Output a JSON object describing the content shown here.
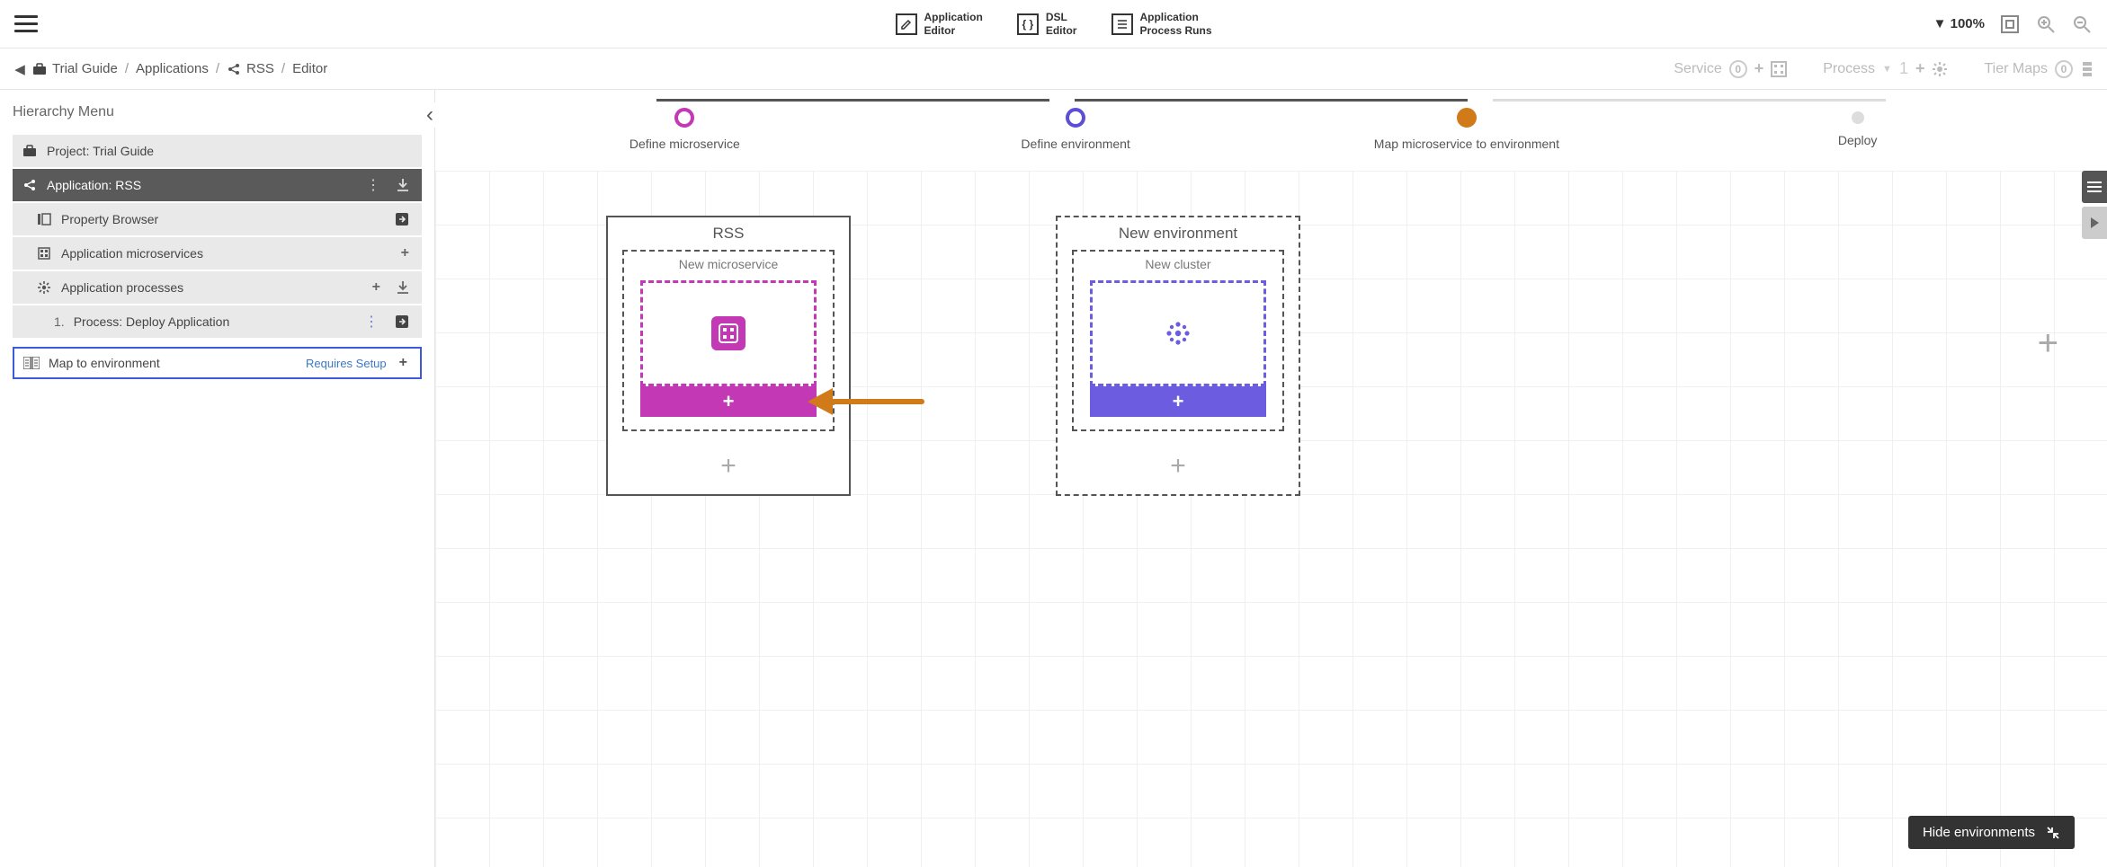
{
  "topbar": {
    "tabs": [
      {
        "line1": "Application",
        "line2": "Editor"
      },
      {
        "line1": "DSL",
        "line2": "Editor"
      },
      {
        "line1": "Application",
        "line2": "Process Runs"
      }
    ],
    "zoom": "100%"
  },
  "breadcrumb": {
    "items": [
      "Trial Guide",
      "Applications",
      "RSS",
      "Editor"
    ]
  },
  "crumb_right": {
    "service": {
      "label": "Service",
      "count": "0"
    },
    "process": {
      "label": "Process",
      "count": "1"
    },
    "tiermaps": {
      "label": "Tier Maps",
      "count": "0"
    }
  },
  "sidebar": {
    "title": "Hierarchy Menu",
    "items": {
      "project": "Project: Trial Guide",
      "application": "Application: RSS",
      "property_browser": "Property Browser",
      "app_microservices": "Application microservices",
      "app_processes": "Application processes",
      "process_deploy_num": "1.",
      "process_deploy": "Process: Deploy Application",
      "map_env": "Map to environment",
      "requires_setup": "Requires Setup"
    }
  },
  "stepper": {
    "s1": "Define microservice",
    "s2": "Define environment",
    "s3": "Map microservice to environment",
    "s4": "Deploy"
  },
  "cards": {
    "rss": {
      "title": "RSS",
      "inner_label": "New microservice"
    },
    "env": {
      "title": "New environment",
      "inner_label": "New cluster"
    }
  },
  "hide_env": "Hide environments"
}
